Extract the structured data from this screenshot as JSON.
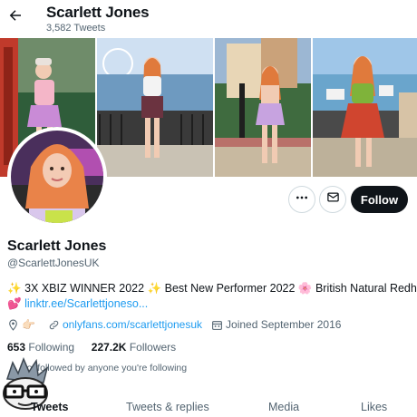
{
  "header": {
    "name": "Scarlett Jones",
    "tweet_count": "3,582 Tweets",
    "back_icon": "arrow-left-icon"
  },
  "actions": {
    "more_icon": "ellipsis-icon",
    "message_icon": "envelope-icon",
    "follow_label": "Follow"
  },
  "profile": {
    "name": "Scarlett Jones",
    "handle": "@ScarlettJonesUK",
    "bio": {
      "sparkle1": "✨",
      "text1": "3X XBIZ WINNER 2022",
      "sparkle2": "✨",
      "text2": "Best New Performer 2022",
      "flower": "🌸",
      "text3": "British Natural Redhead",
      "heart": "💕",
      "link": "linktr.ee/Scarlettjoneso..."
    },
    "location_icon": "location-pin-icon",
    "pointing": "👉🏻",
    "website_icon": "link-icon",
    "website": "onlyfans.com/scarlettjonesuk",
    "joined_icon": "calendar-icon",
    "joined": "Joined September 2016"
  },
  "stats": {
    "following_count": "653",
    "following_label": "Following",
    "followers_count": "227.2K",
    "followers_label": "Followers",
    "not_followed": "Not followed by anyone you're following"
  },
  "tabs": [
    {
      "label": "Tweets",
      "active": true
    },
    {
      "label": "Tweets & replies",
      "active": false
    },
    {
      "label": "Media",
      "active": false
    },
    {
      "label": "Likes",
      "active": false
    }
  ],
  "colors": {
    "accent": "#1d9bf0",
    "follow_bg": "#0f1419",
    "muted": "#536471"
  }
}
